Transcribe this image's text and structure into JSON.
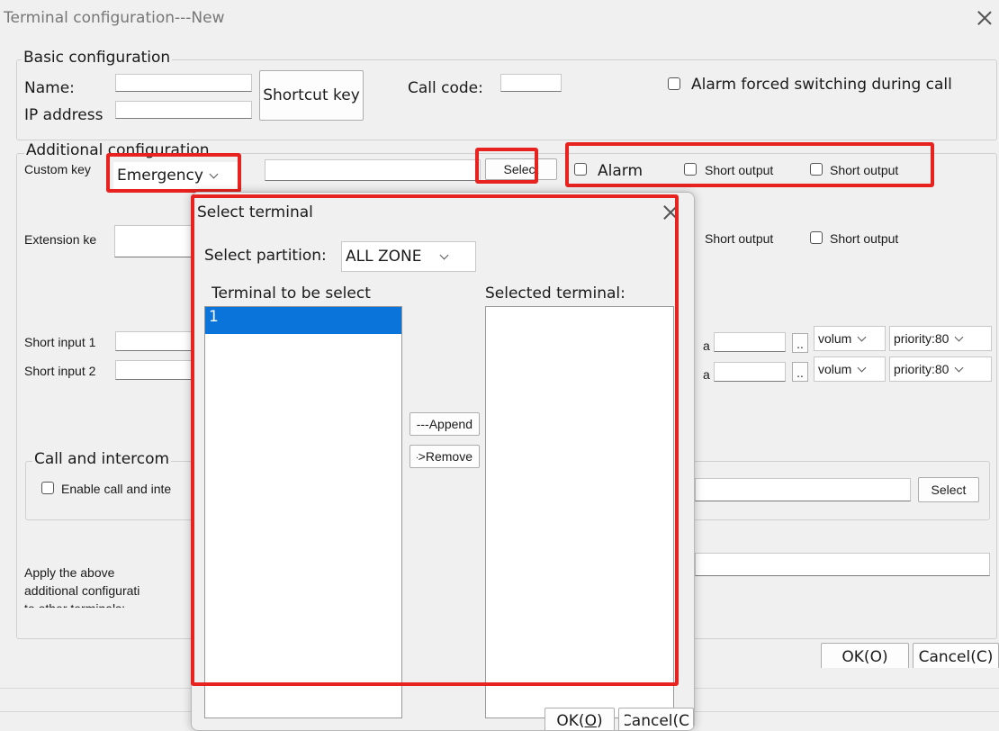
{
  "window": {
    "title": "Terminal configuration---New"
  },
  "basic": {
    "title": "Basic configuration",
    "name_label": "Name:",
    "ip_label": "IP address",
    "shortcut_button": "Shortcut key",
    "call_code_label": "Call code:",
    "alarm_switch_label": "Alarm forced switching during call"
  },
  "additional": {
    "title": "Additional configuration",
    "custom_key_label": "Custom key",
    "custom_key_combo": "Emergency",
    "select_button": "Select",
    "alarm_label": "Alarm",
    "short_output_1": "Short output",
    "short_output_2": "Short output",
    "extension_label": "Extension ke",
    "ext_short_output_1": "Short output",
    "ext_short_output_2": "Short output",
    "short_input_1_label": "Short input 1",
    "short_input_2_label": "Short input 2",
    "row1_partial_label": "a",
    "row2_partial_label": "a",
    "dots": "..",
    "volume_combo_1": "volum",
    "volume_combo_2": "volum",
    "priority_combo_1": "priority:80",
    "priority_combo_2": "priority:80"
  },
  "call": {
    "title": "Call and intercom",
    "enable_label": "Enable call and inte",
    "select_button": "Select"
  },
  "apply": {
    "line1": "Apply the above",
    "line2": "additional configurati",
    "line3": "to other terminals:"
  },
  "main_buttons": {
    "ok": "OK(O)",
    "cancel": "Cancel(C)"
  },
  "dialog": {
    "title": "Select terminal",
    "partition_label": "Select partition:",
    "partition_value": "ALL ZONE",
    "left_header": "Terminal to be select",
    "right_header": "Selected terminal:",
    "left_items": [
      "1"
    ],
    "append_button": "Append--->",
    "remove_button": "Remove<--",
    "ok_prefix": "OK(",
    "ok_key": "O",
    "ok_suffix": ")",
    "cancel_button": "Cancel(C"
  },
  "colors": {
    "highlight": "#e8231f",
    "selection": "#0a74da"
  }
}
